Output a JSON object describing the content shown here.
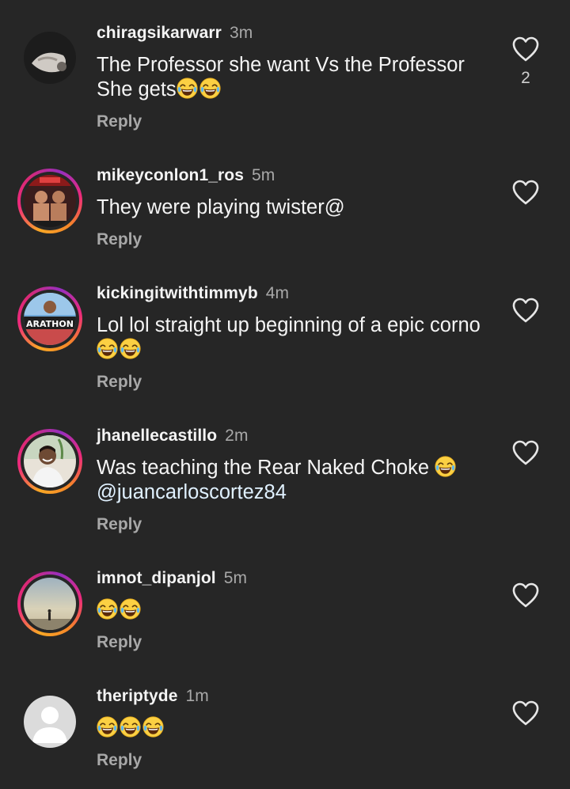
{
  "comments": [
    {
      "username": "chiragsikarwarr",
      "time": "3m",
      "text": "The Professor she want Vs the Professor She gets",
      "emoji_count": 2,
      "reply_label": "Reply",
      "like_count": "2",
      "avatar": "photo-avatar"
    },
    {
      "username": "mikeyconlon1_ros",
      "time": "5m",
      "text": "They were playing twister@",
      "emoji_count": 0,
      "reply_label": "Reply",
      "like_count": "",
      "avatar": "photo-avatar-story-ring"
    },
    {
      "username": "kickingitwithtimmyb",
      "time": "4m",
      "text": "Lol lol straight up beginning of a epic corno",
      "emoji_count": 2,
      "reply_label": "Reply",
      "like_count": "",
      "avatar": "photo-avatar-story-ring",
      "avatar_text": "ARATHON"
    },
    {
      "username": "jhanellecastillo",
      "time": "2m",
      "text": "Was teaching the Rear Naked Choke",
      "mention": "@juancarloscortez84",
      "emoji_count": 1,
      "reply_label": "Reply",
      "like_count": "",
      "avatar": "photo-avatar-story-ring"
    },
    {
      "username": "imnot_dipanjol",
      "time": "5m",
      "text": "",
      "emoji_count": 2,
      "reply_label": "Reply",
      "like_count": "",
      "avatar": "photo-avatar-story-ring"
    },
    {
      "username": "theriptyde",
      "time": "1m",
      "text": "",
      "emoji_count": 3,
      "reply_label": "Reply",
      "like_count": "",
      "avatar": "default-avatar"
    }
  ],
  "icons": {
    "like": "heart-outline-icon",
    "emoji": "face-with-tears-of-joy-icon"
  },
  "colors": {
    "background": "#262626",
    "secondary_text": "#a8a8a8",
    "primary_text": "#f5f5f5",
    "mention": "#e0f1ff"
  }
}
